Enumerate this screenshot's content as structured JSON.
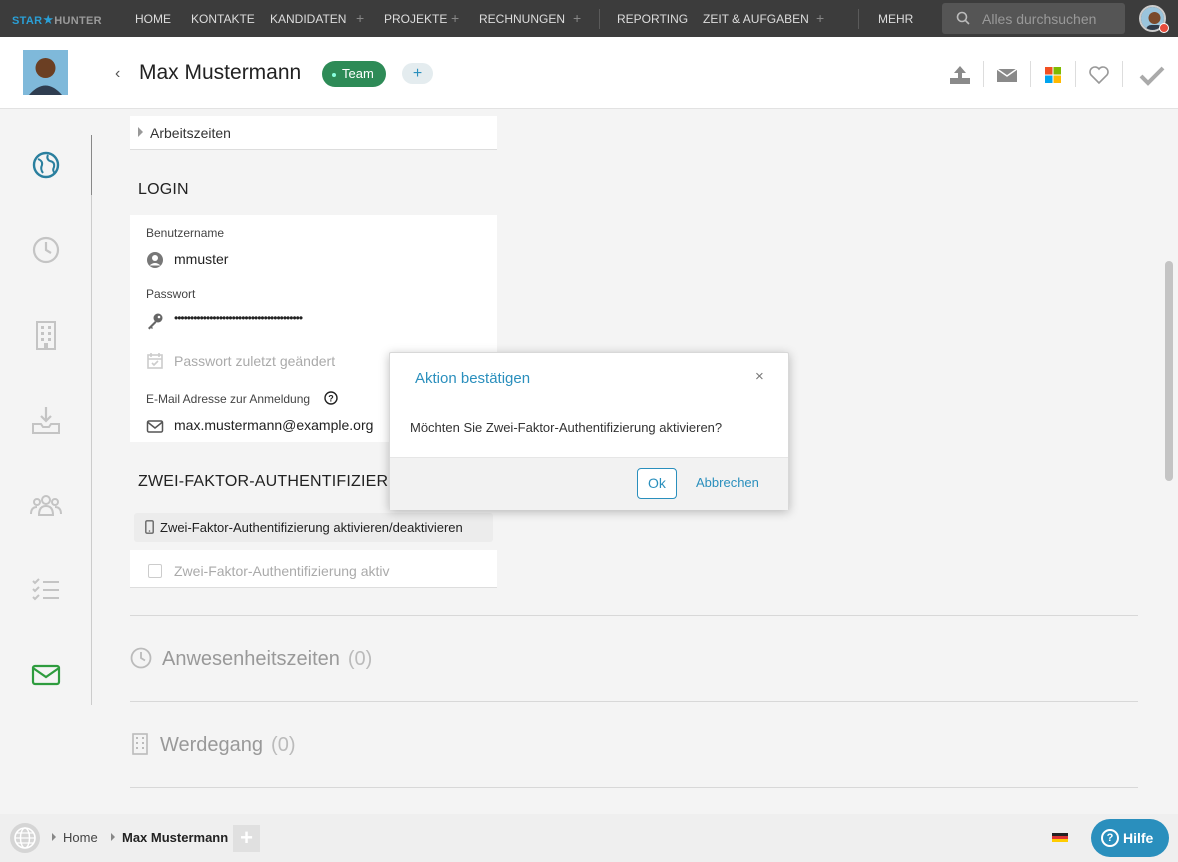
{
  "nav": {
    "logo_part1": "STAR",
    "logo_part2": "HUNTER",
    "items": [
      "HOME",
      "KONTAKTE",
      "KANDIDATEN",
      "PROJEKTE",
      "RECHNUNGEN",
      "REPORTING",
      "ZEIT & AUFGABEN",
      "MEHR"
    ],
    "plus": "+",
    "search_placeholder": "Alles durchsuchen"
  },
  "header": {
    "back": "‹",
    "name": "Max Mustermann",
    "badge": "Team",
    "add_badge": "+"
  },
  "form": {
    "collapsed_section": "Arbeitszeiten",
    "login_title": "LOGIN",
    "username_label": "Benutzername",
    "username": "mmuster",
    "password_label": "Passwort",
    "password": "••••••••••••••••••••••••••••••••••••••••",
    "password_changed": "Passwort zuletzt geändert",
    "email_label": "E-Mail Adresse zur Anmeldung",
    "email": "max.mustermann@example.org",
    "twofa_title": "ZWEI-FAKTOR-AUTHENTIFIZIERUNG",
    "twofa_button": "Zwei-Faktor-Authentifizierung aktivieren/deaktivieren",
    "twofa_checkbox": "Zwei-Faktor-Authentifizierung aktiv"
  },
  "sections": {
    "attendance": "Anwesenheitszeiten",
    "attendance_count": "(0)",
    "career": "Werdegang",
    "career_count": "(0)"
  },
  "dialog": {
    "title": "Aktion bestätigen",
    "message": "Möchten Sie Zwei-Faktor-Authentifizierung aktivieren?",
    "ok": "Ok",
    "cancel": "Abbrechen",
    "close": "×"
  },
  "footer": {
    "breadcrumbs": [
      "Home",
      "Max Mustermann"
    ],
    "add": "+",
    "help": "Hilfe",
    "help_icon": "?"
  },
  "colors": {
    "accent": "#2a8fbd",
    "team_badge": "#2e8b57",
    "nav_bg": "#3c3c3c",
    "active_rail": "#2e9c3e"
  }
}
